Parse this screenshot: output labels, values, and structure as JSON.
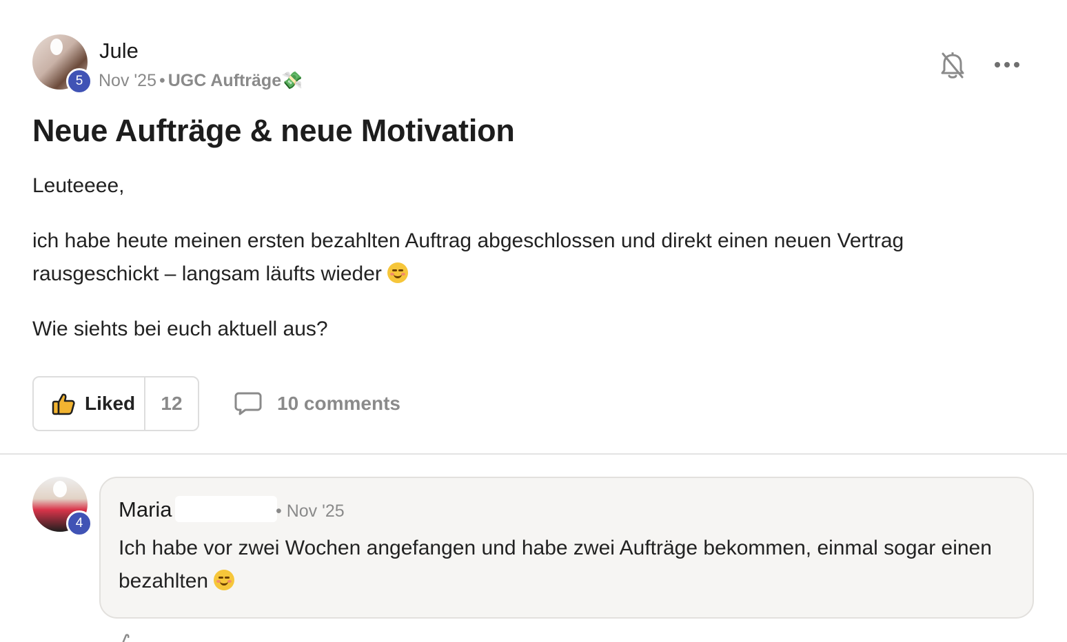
{
  "post": {
    "author": "Jule",
    "author_level": "5",
    "date": "Nov '25",
    "separator": "•",
    "category": "UGC Aufträge💸",
    "title": "Neue Aufträge & neue Motivation",
    "paragraphs": [
      "Leuteeee,",
      "ich habe heute meinen ersten bezahlten Auftrag abgeschlossen und direkt einen neuen Vertrag rausgeschickt – langsam läufts wieder",
      "Wie siehts bei euch aktuell aus?"
    ],
    "like_label": "Liked",
    "like_count": "12",
    "comments_label": "10 comments"
  },
  "comment": {
    "author": "Maria",
    "author_level": "4",
    "date": "• Nov '25",
    "text": "Ich habe vor zwei Wochen angefangen und habe zwei Aufträge bekommen, einmal sogar einen bezahlten"
  },
  "icons": {
    "bell": "bell-off-icon",
    "more": "more-horizontal-icon",
    "like": "thumbs-up-icon",
    "comment": "comment-bubble-icon"
  },
  "colors": {
    "level_badge": "#4053b5",
    "like_thumb": "#f2b431",
    "muted_text": "#8a8a8a",
    "comment_bg": "#f6f5f3"
  }
}
